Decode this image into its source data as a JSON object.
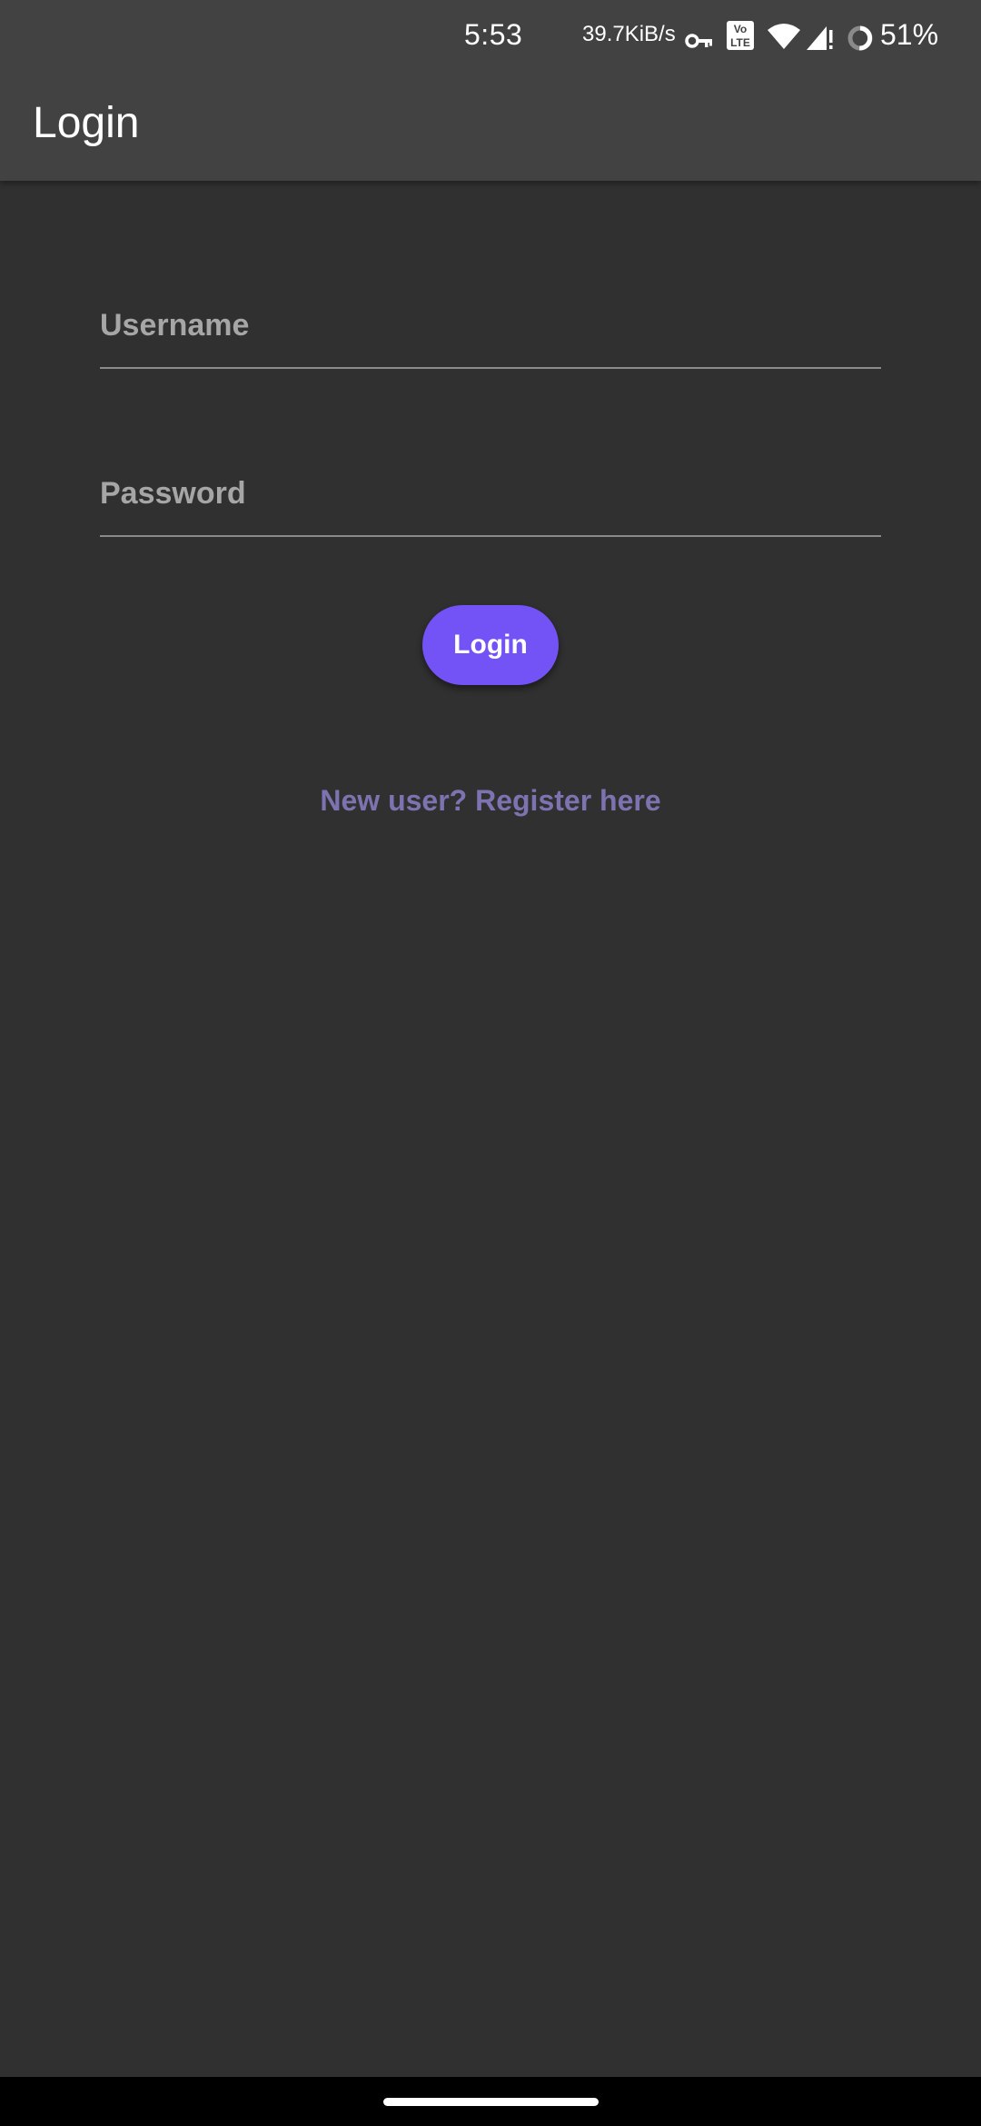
{
  "status_bar": {
    "time": "5:53",
    "network_speed": "39.7KiB/s",
    "battery_percent": "51%",
    "icons": [
      "vpn-key-icon",
      "volte-icon",
      "wifi-icon",
      "cell-signal-icon",
      "battery-icon"
    ]
  },
  "app_bar": {
    "title": "Login"
  },
  "form": {
    "username": {
      "placeholder": "Username",
      "value": ""
    },
    "password": {
      "placeholder": "Password",
      "value": ""
    },
    "login_label": "Login",
    "register_label": "New user? Register here"
  },
  "colors": {
    "background": "#303030",
    "app_bar": "#424242",
    "accent": "#7353f5",
    "link": "#7c74b0"
  }
}
